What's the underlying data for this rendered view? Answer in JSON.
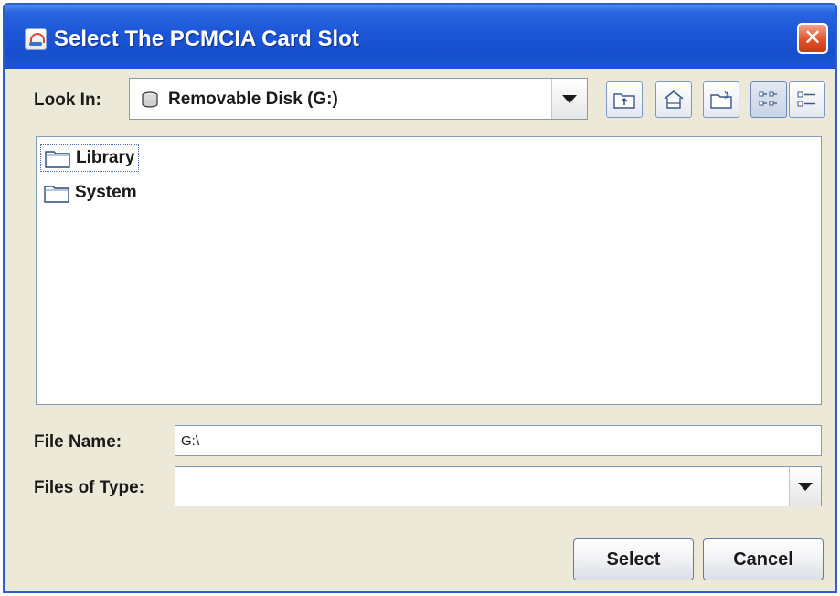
{
  "window": {
    "title": "Select The PCMCIA Card Slot",
    "close_glyph": "✕"
  },
  "look_in": {
    "label": "Look In:",
    "value": "Removable Disk (G:)"
  },
  "toolbar": {
    "buttons": [
      {
        "name": "up-one-level",
        "icon": "folder-up-icon"
      },
      {
        "name": "home",
        "icon": "home-icon"
      },
      {
        "name": "new-folder",
        "icon": "new-folder-icon"
      },
      {
        "name": "list-view",
        "icon": "list-view-icon",
        "active": true
      },
      {
        "name": "details-view",
        "icon": "details-view-icon"
      }
    ]
  },
  "files": [
    {
      "name": "Library",
      "selected": true
    },
    {
      "name": "System",
      "selected": false
    }
  ],
  "file_name": {
    "label": "File Name:",
    "value": "G:\\"
  },
  "files_of_type": {
    "label": "Files of Type:",
    "value": ""
  },
  "buttons": {
    "select": "Select",
    "cancel": "Cancel"
  },
  "colors": {
    "titlebar": "#1c55d6",
    "close": "#e2522b",
    "dialog_bg": "#ece9d8",
    "field_border": "#7f9db9"
  }
}
